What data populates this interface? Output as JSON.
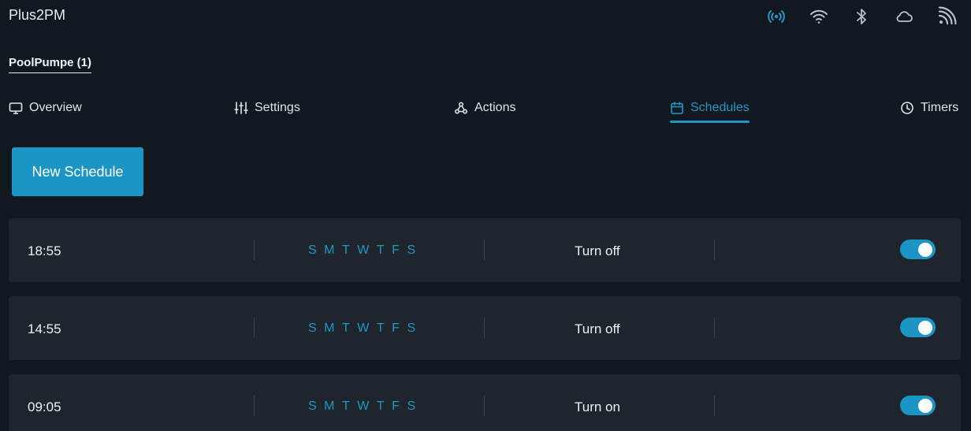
{
  "device": {
    "title": "Plus2PM"
  },
  "status_icons": [
    {
      "name": "radio-signal-icon",
      "color": "#2396c4"
    },
    {
      "name": "wifi-icon",
      "color": "#b9c0c7"
    },
    {
      "name": "bluetooth-icon",
      "color": "#b9c0c7"
    },
    {
      "name": "cloud-icon",
      "color": "#b9c0c7"
    },
    {
      "name": "rss-icon",
      "color": "#b9c0c7"
    }
  ],
  "channel_tab": {
    "label": "PoolPumpe (1)"
  },
  "nav": {
    "items": [
      {
        "label": "Overview",
        "icon": "monitor-icon"
      },
      {
        "label": "Settings",
        "icon": "sliders-icon"
      },
      {
        "label": "Actions",
        "icon": "webhook-icon"
      },
      {
        "label": "Schedules",
        "icon": "calendar-icon",
        "active": true
      },
      {
        "label": "Timers",
        "icon": "clock-icon"
      }
    ]
  },
  "new_schedule_button": {
    "label": "New Schedule"
  },
  "schedules": [
    {
      "time": "18:55",
      "days": [
        "S",
        "M",
        "T",
        "W",
        "T",
        "F",
        "S"
      ],
      "action": "Turn off",
      "enabled": true
    },
    {
      "time": "14:55",
      "days": [
        "S",
        "M",
        "T",
        "W",
        "T",
        "F",
        "S"
      ],
      "action": "Turn off",
      "enabled": true
    },
    {
      "time": "09:05",
      "days": [
        "S",
        "M",
        "T",
        "W",
        "T",
        "F",
        "S"
      ],
      "action": "Turn on",
      "enabled": true
    }
  ],
  "colors": {
    "accent": "#1b95c4",
    "background": "#12181f",
    "row": "#1e252d"
  }
}
